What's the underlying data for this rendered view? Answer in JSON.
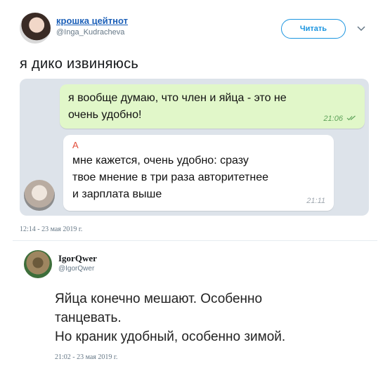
{
  "tweet": {
    "display_name": "крошка цейтнот",
    "handle": "@Inga_Kudracheva",
    "follow_label": "Читать",
    "chevron_icon": "chevron-down-icon",
    "text": "я дико извиняюсь",
    "timestamp": "12:14 - 23 мая 2019 г."
  },
  "chat": {
    "outgoing": {
      "lines": [
        "я вообще думаю, что член и яйца - это не",
        "очень удобно!"
      ],
      "time": "21:06",
      "status_icon": "double-check-icon"
    },
    "incoming": {
      "sender": "А",
      "lines": [
        "мне кажется, очень удобно: сразу",
        "твое мнение в три раза авторитетнее",
        "и зарплата выше"
      ],
      "time": "21:11"
    }
  },
  "reply": {
    "display_name": "IgorQwer",
    "handle": "@IgorQwer",
    "lines": [
      "Яйца конечно мешают. Особенно",
      "танцевать.",
      "Но краник удобный, особенно зимой."
    ],
    "timestamp": "21:02 - 23 мая 2019 г."
  }
}
